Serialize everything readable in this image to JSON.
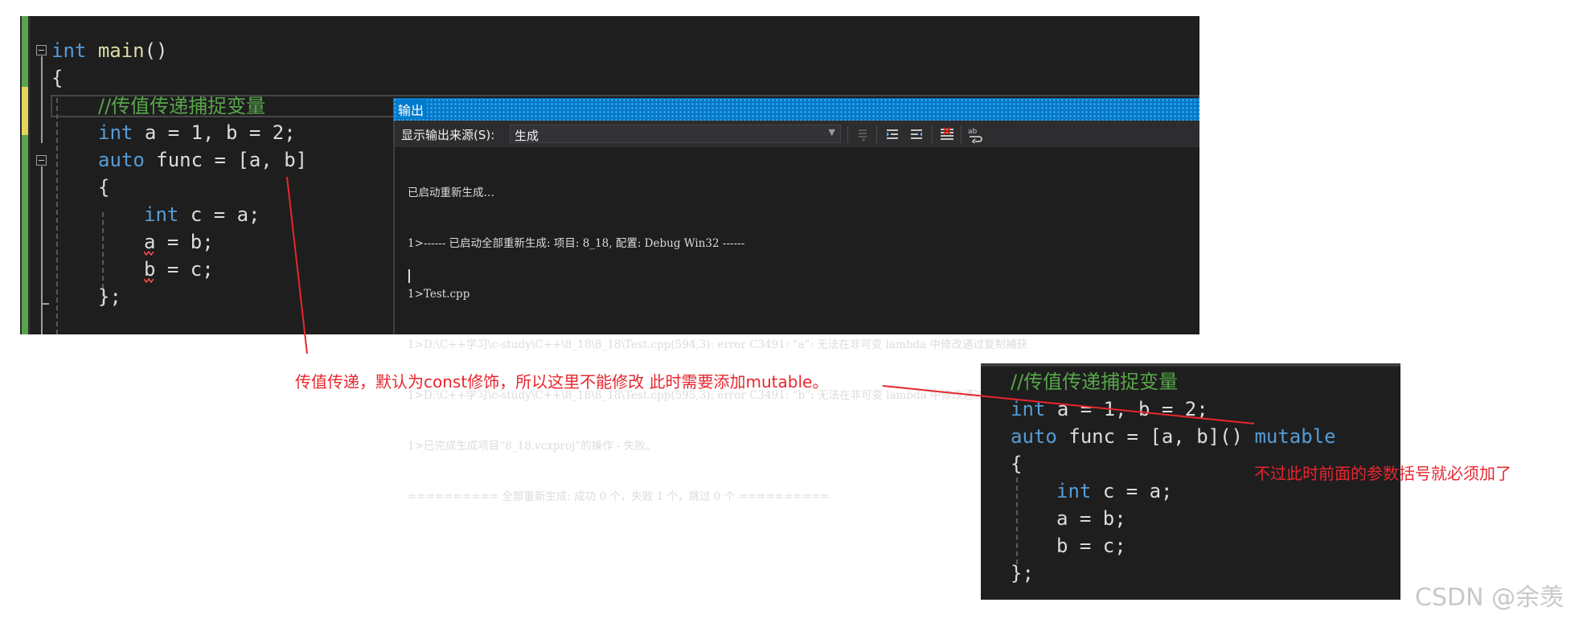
{
  "editor": {
    "line1": {
      "kw": "int",
      "fn": "main",
      "rest": "()"
    },
    "line2": "{",
    "line3": "//传值传递捕捉变量",
    "line4": {
      "kw": "int",
      "rest": "a = 1, b = 2;"
    },
    "line5": {
      "kw": "auto",
      "rest": "func = [a, b]"
    },
    "line6": "{",
    "line7": {
      "kw": "int",
      "rest": "c = a;"
    },
    "line8": "a = b;",
    "line9": "b = c;",
    "line10": "};"
  },
  "output_panel": {
    "title": "输出",
    "source_label": "显示输出来源(S):",
    "source_value": "生成",
    "log_lines": [
      "已启动重新生成…",
      "1>------ 已启动全部重新生成: 项目: 8_18, 配置: Debug Win32 ------",
      "1>Test.cpp",
      "1>D:\\C++学习\\c-study\\C++\\8_18\\8_18\\Test.cpp(594,3): error C3491: “a”: 无法在非可变 lambda 中修改通过复制捕获",
      "1>D:\\C++学习\\c-study\\C++\\8_18\\8_18\\Test.cpp(595,3): error C3491: “b”: 无法在非可变 lambda 中修改通过复制捕获",
      "1>已完成生成项目“8_18.vcxproj”的操作 - 失败。",
      "========== 全部重新生成: 成功 0 个，失败 1 个，跳过 0 个 =========="
    ]
  },
  "annotations": {
    "note1": "传值传递，默认为const修饰，所以这里不能修改 此时需要添加mutable。",
    "note2": "不过此时前面的参数括号就必须加了"
  },
  "snippet": {
    "line1": "//传值传递捕捉变量",
    "line2": {
      "kw": "int",
      "rest": "a = 1, b = 2;"
    },
    "line3": {
      "kw": "auto",
      "rest": "func = [a, b]()",
      "kw2": "mutable"
    },
    "line4": "{",
    "line5": {
      "kw": "int",
      "rest": "c = a;"
    },
    "line6": "a = b;",
    "line7": "b = c;",
    "line8": "};"
  },
  "watermark": "CSDN @余羡",
  "colors": {
    "keyword": "#569cd6",
    "comment": "#57a64a",
    "annotation": "#e8262d",
    "output_title": "#007acc"
  }
}
